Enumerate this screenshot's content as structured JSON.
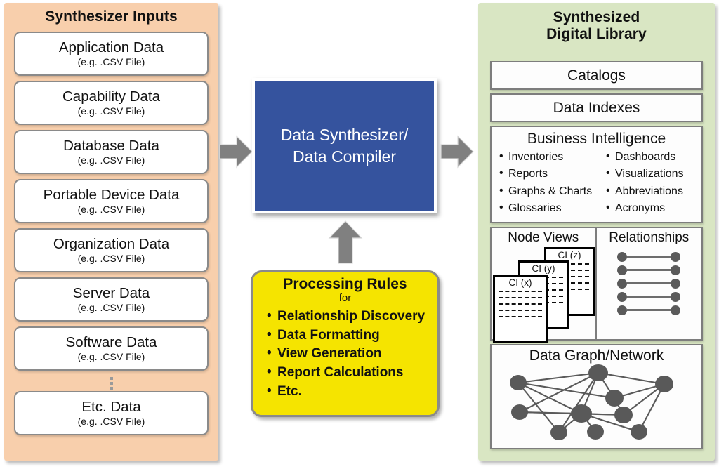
{
  "inputs": {
    "title": "Synthesizer Inputs",
    "panel_color": "#F8CFAC",
    "items": [
      {
        "name": "Application Data",
        "sub": "(e.g. .CSV File)"
      },
      {
        "name": "Capability Data",
        "sub": "(e.g. .CSV File)"
      },
      {
        "name": "Database Data",
        "sub": "(e.g. .CSV File)"
      },
      {
        "name": "Portable Device Data",
        "sub": "(e.g. .CSV File)"
      },
      {
        "name": "Organization Data",
        "sub": "(e.g. .CSV File)"
      },
      {
        "name": "Server Data",
        "sub": "(e.g. .CSV File)"
      },
      {
        "name": "Software Data",
        "sub": "(e.g. .CSV File)"
      }
    ],
    "ellipsis": "vertical-dots",
    "last_item": {
      "name": "Etc. Data",
      "sub": "(e.g. .CSV File)"
    }
  },
  "synthesizer": {
    "line1": "Data Synthesizer/",
    "line2": "Data Compiler",
    "box_color": "#35539E",
    "text_color": "#FFFFFF"
  },
  "rules": {
    "title": "Processing Rules",
    "subtitle": "for",
    "box_color": "#F5E400",
    "items": [
      "Relationship Discovery",
      "Data Formatting",
      "View Generation",
      "Report Calculations",
      "Etc."
    ]
  },
  "arrows": {
    "input_to_synth": "arrow-right-icon",
    "synth_to_library": "arrow-right-icon",
    "rules_to_synth": "arrow-up-icon",
    "color": "#808080"
  },
  "library": {
    "title_line1": "Synthesized",
    "title_line2": "Digital Library",
    "panel_color": "#D9E6C3",
    "catalogs": "Catalogs",
    "data_indexes": "Data Indexes",
    "business_intelligence": {
      "title": "Business Intelligence",
      "column_left": [
        "Inventories",
        "Reports",
        "Graphs & Charts",
        "Glossaries"
      ],
      "column_right": [
        "Dashboards",
        "Visualizations",
        "Abbreviations",
        "Acronyms"
      ]
    },
    "node_views": {
      "title": "Node Views",
      "cards": [
        "CI (z)",
        "CI (y)",
        "CI (x)"
      ]
    },
    "relationships": {
      "title": "Relationships",
      "row_count": 5
    },
    "data_graph": {
      "title": "Data Graph/Network",
      "node_count": 10
    }
  }
}
